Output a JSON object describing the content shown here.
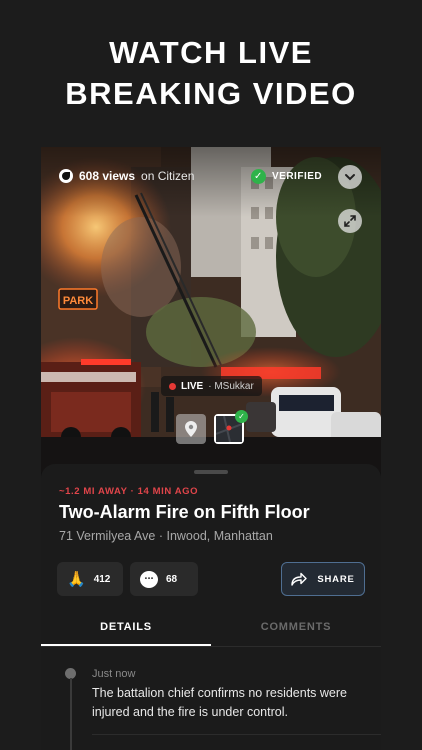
{
  "promo": {
    "line1": "WATCH LIVE",
    "line2": "BREAKING VIDEO"
  },
  "video": {
    "views_count": "608 views",
    "views_suffix": "on Citizen",
    "verified_label": "VERIFIED",
    "sign_text": "PARK",
    "live_label": "LIVE",
    "live_user": "· MSukkar"
  },
  "incident": {
    "meta": "~1.2 MI AWAY · 14 MIN AGO",
    "title": "Two-Alarm Fire on Fifth Floor",
    "address": "71 Vermilyea Ave · Inwood, Manhattan"
  },
  "reactions": {
    "pray_count": "412",
    "comment_count": "68",
    "chat_glyph": "...",
    "share_label": "SHARE"
  },
  "tabs": [
    {
      "label": "DETAILS",
      "active": true
    },
    {
      "label": "COMMENTS",
      "active": false
    }
  ],
  "updates": [
    {
      "time": "Just now",
      "text": "The battalion chief confirms no residents were injured and the fire is under control."
    }
  ],
  "icons": {
    "views": "views-eye-icon",
    "verified": "checkmark-icon",
    "collapse": "chevron-down-icon",
    "expand": "expand-arrows-icon",
    "pin": "location-pin-icon",
    "map": "map-thumbnail-icon",
    "pray": "praying-hands-icon",
    "comment": "comment-bubble-icon",
    "share": "share-arrow-icon"
  },
  "colors": {
    "background": "#1c1c1c",
    "sheet": "#1b1b1b",
    "meta_red": "#e0454a",
    "verified_green": "#2fb34a",
    "live_red": "#e53935",
    "share_border": "#4f6e91"
  }
}
